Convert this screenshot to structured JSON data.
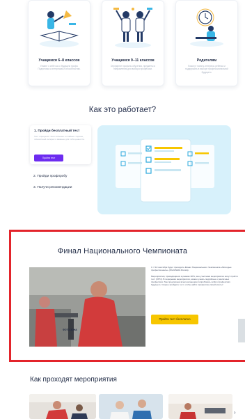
{
  "audience_cards": [
    {
      "title": "Учащимся 6–8 классов",
      "description": "Узнают о себе как о будущем профи. Подготовка к интересам и способностям."
    },
    {
      "title": "Учащимся 9–11 классов",
      "description": "Определят профиль обучения, предметы и направления для выбора профессии."
    },
    {
      "title": "Родителям",
      "description": "Помогут понять интересы ребенка и поддержать в выборе профессиональной будущего."
    }
  ],
  "how_it_works": {
    "title": "Как это работает?",
    "step1_title": "1. Пройди бесплатный тест",
    "step1_desc": "Тест определит твои сильные и слабые стороны, личностный интерес и важные для тебя ценности.",
    "step1_button": "Пройти тест",
    "step2": "2. Пройди профпробу",
    "step3": "3. Получи рекомендации"
  },
  "final": {
    "title": "Финал Национального Чемпионата",
    "photo_caption": "ФОТО ЗОНА",
    "text_1": "С 7-10 сентября будет проходить Финал Национального Чемпионата «Молодые профессионалы» (WorldSkills Russia).",
    "text_2": "Мероприятия, проводящиеся в рамках ФНЧ, все участники мероприятия могут пройти тест (ОНЧ). В перерывах мероприятия, можно узнать подробнее о различных профессиях. Мы предлагаем всем желающим попробовать себя в профессиях будущего. Скорее пройдите тест, чтобы найти профессию своей мечты!",
    "button": "Пройти тест бесплатно"
  },
  "events": {
    "title": "Как проходят мероприятия"
  },
  "colors": {
    "accent_purple": "#6d2cf0",
    "accent_yellow": "#f7c600",
    "highlight_red": "#e3242b",
    "illustration_bg": "#d7f1fb"
  }
}
